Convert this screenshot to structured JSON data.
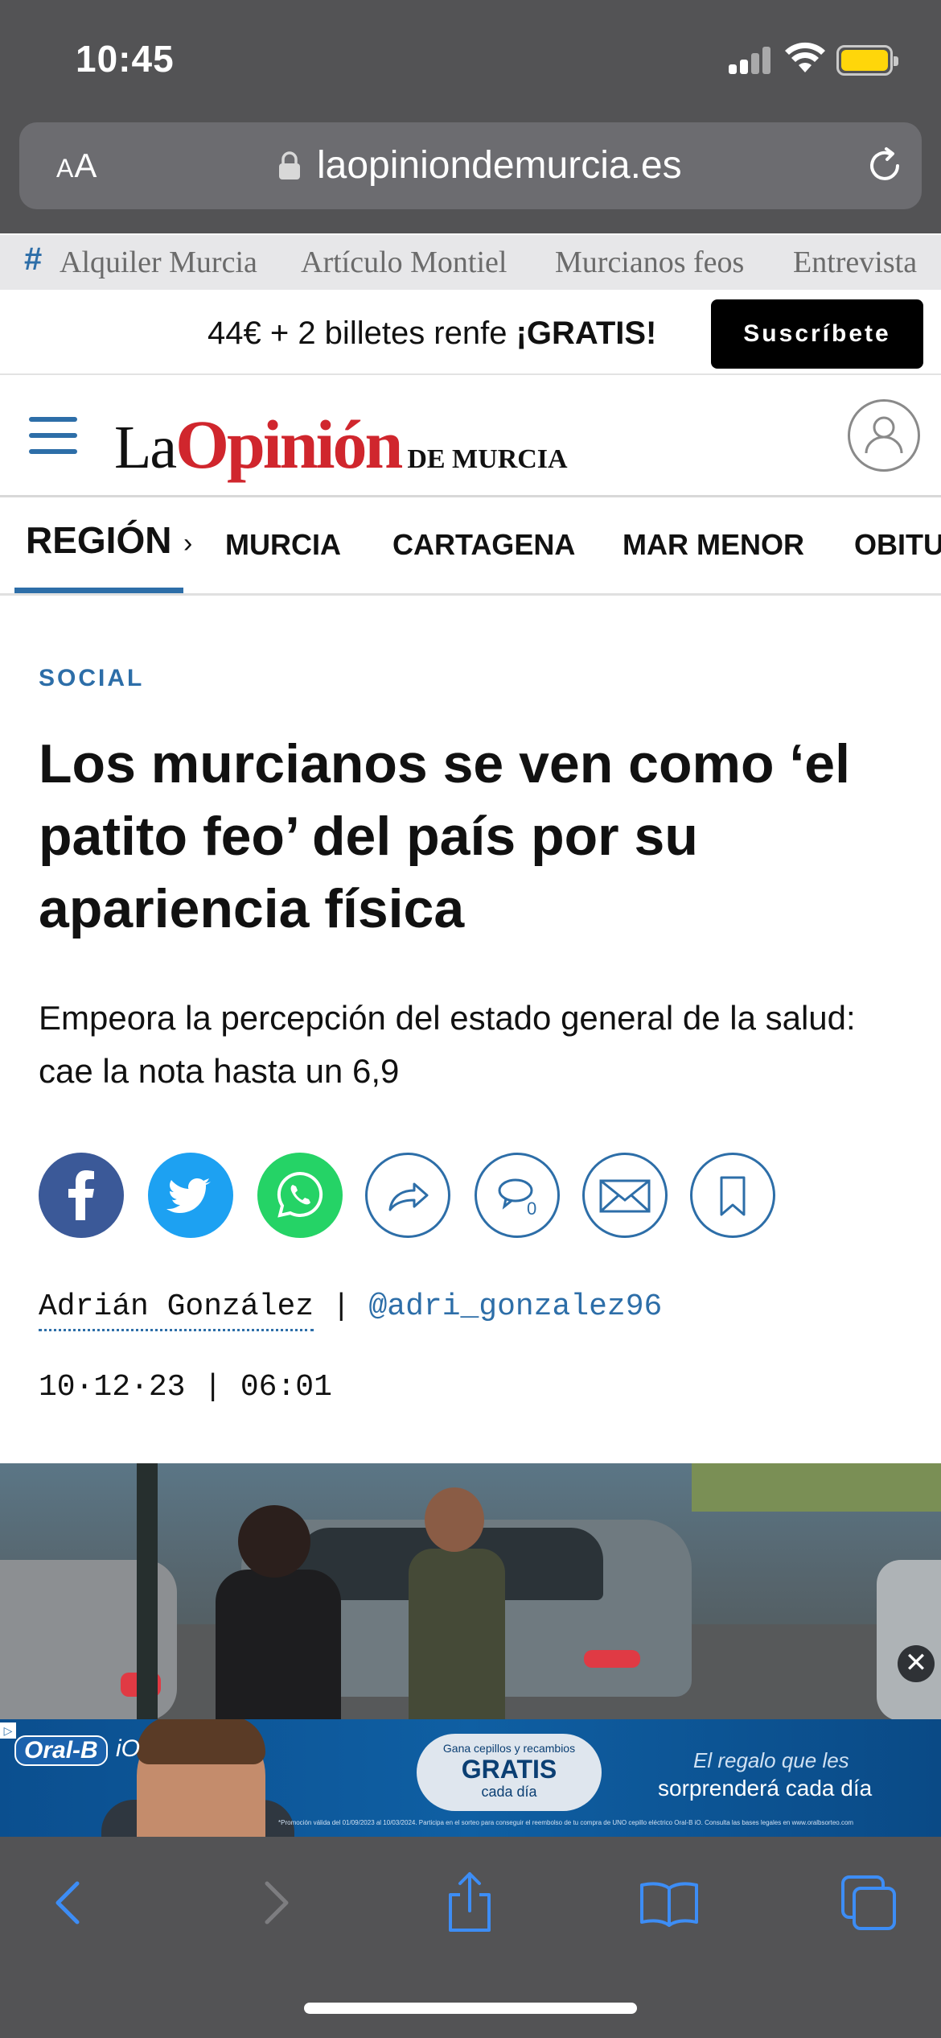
{
  "status_bar": {
    "time": "10:45"
  },
  "browser": {
    "reader_label_small": "A",
    "reader_label_big": "A",
    "url": "laopiniondemurcia.es"
  },
  "trending": {
    "hash": "#",
    "items": [
      "Alquiler Murcia",
      "Artículo Montiel",
      "Murcianos feos",
      "Entrevista"
    ]
  },
  "promo": {
    "text_start": "44€ + 2 billetes renfe ",
    "text_bold": "¡GRATIS!",
    "subscribe_label": "Suscríbete"
  },
  "header": {
    "logo_la": "La",
    "logo_opinion": "Opinión",
    "logo_de_murcia": "DE MURCIA"
  },
  "section_nav": {
    "active": "REGIÓN",
    "chevron": "›",
    "items": [
      "MURCIA",
      "CARTAGENA",
      "MAR MENOR",
      "OBITU"
    ]
  },
  "article": {
    "kicker": "SOCIAL",
    "headline": "Los murcianos se ven como ‘el patito feo’ del país por su apariencia física",
    "subtitle": "Empeora la percepción del estado general de la salud: cae la nota hasta un 6,9",
    "comment_count": "0",
    "author": "Adrián González",
    "byline_sep": " | ",
    "handle": "@adri_gonzalez96",
    "date": "10·12·23",
    "time": "06:01"
  },
  "ad": {
    "close": "✕",
    "brand": "Oral-B",
    "brand_sub": "iO",
    "pill_small": "Gana cepillos y recambios",
    "pill_big": "GRATIS",
    "pill_sub": "cada día",
    "tagline_1": "El regalo que les",
    "tagline_2": "sorprenderá cada día",
    "fine_print": "*Promoción válida del 01/09/2023 al 10/03/2024. Participa en el sorteo para conseguir el reembolso de tu compra de UNO cepillo eléctrico Oral-B iO. Consulta las bases legales en www.oralbsorteo.com"
  },
  "colors": {
    "accent": "#2d6ea8",
    "logo_red": "#d0262d",
    "facebook": "#3b5998",
    "twitter": "#1da1f2",
    "whatsapp": "#25d366",
    "browser_chrome": "#535355",
    "ios_blue": "#3d8df5"
  },
  "icons": {
    "share": [
      "facebook-icon",
      "twitter-icon",
      "whatsapp-icon",
      "share-icon",
      "comment-icon",
      "mail-icon",
      "bookmark-icon"
    ],
    "toolbar": [
      "back-icon",
      "forward-icon",
      "share-icon",
      "bookmarks-icon",
      "tabs-icon"
    ]
  }
}
